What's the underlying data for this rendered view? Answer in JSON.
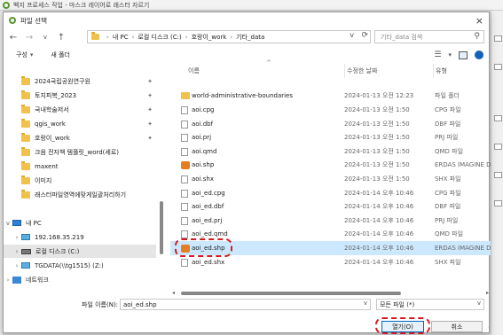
{
  "app": {
    "title": "벡지 프로세스 작업 - 마스크 레이어로 래스터 자르기"
  },
  "dialog": {
    "title": "파일 선택"
  },
  "nav": {
    "breadcrumbs": [
      "내 PC",
      "로컬 디스크 (C:)",
      "호랑이_work",
      "기타_data"
    ],
    "search_placeholder": "기타_data 검색"
  },
  "toolbar": {
    "organize": "구성",
    "new_folder": "새 폴더"
  },
  "sidebar": {
    "items": [
      {
        "label": "2024국립공원연구원",
        "pinned": true
      },
      {
        "label": "토지피복_2023",
        "pinned": true
      },
      {
        "label": "국내학술저서",
        "pinned": true
      },
      {
        "label": "qgis_work",
        "pinned": true
      },
      {
        "label": "호랑이_work",
        "pinned": true
      },
      {
        "label": "크음 전자책 템플릿_word(세로)",
        "pinned": false
      },
      {
        "label": "maxent",
        "pinned": false
      },
      {
        "label": "이미지",
        "pinned": false
      },
      {
        "label": "래스터파일영역에맞게일괄처리하기",
        "pinned": false
      }
    ],
    "pc": "내 PC",
    "drives": [
      "192.168.35.219",
      "로컬 디스크 (C:)",
      "TGDATA(\\\\tg1515) (Z:)"
    ],
    "network": "네트워크"
  },
  "columns": {
    "name": "이름",
    "date": "수정한 날짜",
    "type": "유형"
  },
  "files": [
    {
      "name": "world-administrative-boundaries",
      "date": "2024-01-13 오전 12:23",
      "type": "파일 폴더",
      "icon": "folder"
    },
    {
      "name": "aoi.cpg",
      "date": "2024-01-13 오전 1:50",
      "type": "CPG 파일",
      "icon": "file"
    },
    {
      "name": "aoi.dbf",
      "date": "2024-01-13 오전 1:50",
      "type": "DBF 파일",
      "icon": "file"
    },
    {
      "name": "aoi.prj",
      "date": "2024-01-13 오전 1:50",
      "type": "PRJ 파일",
      "icon": "file"
    },
    {
      "name": "aoi.qmd",
      "date": "2024-01-13 오전 1:50",
      "type": "QMD 파일",
      "icon": "file"
    },
    {
      "name": "aoi.shp",
      "date": "2024-01-13 오전 1:50",
      "type": "ERDAS IMAGINE D",
      "icon": "shp"
    },
    {
      "name": "aoi.shx",
      "date": "2024-01-13 오전 1:50",
      "type": "SHX 파일",
      "icon": "file"
    },
    {
      "name": "aoi_ed.cpg",
      "date": "2024-01-14 오후 10:46",
      "type": "CPG 파일",
      "icon": "file"
    },
    {
      "name": "aoi_ed.dbf",
      "date": "2024-01-14 오후 10:46",
      "type": "DBF 파일",
      "icon": "file"
    },
    {
      "name": "aoi_ed.prj",
      "date": "2024-01-14 오후 10:46",
      "type": "PRJ 파일",
      "icon": "file"
    },
    {
      "name": "aoi_ed.qmd",
      "date": "2024-01-14 오후 10:46",
      "type": "QMD 파일",
      "icon": "file"
    },
    {
      "name": "aoi_ed.shp",
      "date": "2024-01-14 오후 10:46",
      "type": "ERDAS IMAGINE D",
      "icon": "shp",
      "selected": true
    },
    {
      "name": "aoi_ed.shx",
      "date": "2024-01-14 오후 10:46",
      "type": "SHX 파일",
      "icon": "file"
    }
  ],
  "bottom": {
    "filename_label": "파일 이름(N):",
    "filename_value": "aoi_ed.shp",
    "filter": "모든 파일 (*)",
    "open": "열기(O)",
    "cancel": "취소"
  },
  "colors": {
    "selection": "#cce8ff",
    "annotation": "#d71920",
    "folder": "#f0c24b"
  }
}
